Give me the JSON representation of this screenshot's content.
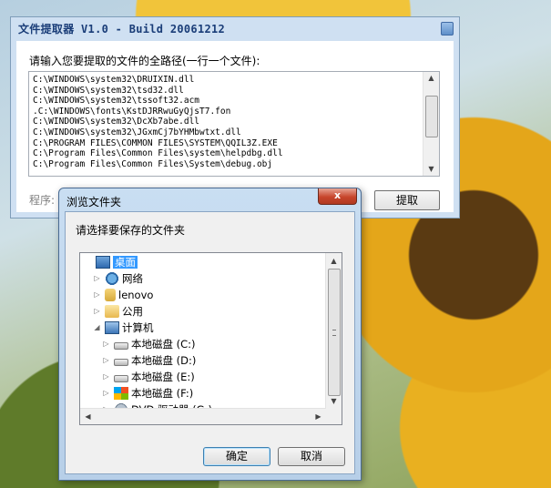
{
  "app": {
    "title": "文件提取器 V1.0 - Build 20061212",
    "prompt": "请输入您要提取的文件的全路径(一行一个文件):",
    "file_lines": [
      "C:\\WINDOWS\\system32\\DRUIXIN.dll",
      "C:\\WINDOWS\\system32\\tsd32.dll",
      "C:\\WINDOWS\\system32\\tssoft32.acm",
      ".C:\\WINDOWS\\fonts\\KstDJRRwuGyQjsT7.fon",
      "C:\\WINDOWS\\system32\\DcXb7abe.dll",
      "C:\\WINDOWS\\system32\\JGxmCj7bYHMbwtxt.dll",
      "C:\\PROGRAM FILES\\COMMON FILES\\SYSTEM\\QQIL3Z.EXE",
      "C:\\Program Files\\Common Files\\system\\helpdbg.dll",
      "C:\\Program Files\\Common Files\\System\\debug.obj"
    ],
    "status_label": "程序:",
    "extract_label": "提取"
  },
  "dialog": {
    "title": "浏览文件夹",
    "close_label": "x",
    "prompt": "请选择要保存的文件夹",
    "tree": [
      {
        "label": "桌面",
        "icon": "desktop-icon",
        "level": 0,
        "expander": "",
        "selected": true
      },
      {
        "label": "网络",
        "icon": "network-icon",
        "level": 1,
        "expander": "collapsed"
      },
      {
        "label": "lenovo",
        "icon": "user-folder-icon",
        "level": 1,
        "expander": "collapsed"
      },
      {
        "label": "公用",
        "icon": "folder-icon",
        "level": 1,
        "expander": "collapsed"
      },
      {
        "label": "计算机",
        "icon": "computer-icon",
        "level": 1,
        "expander": "expanded"
      },
      {
        "label": "本地磁盘 (C:)",
        "icon": "drive-icon",
        "level": 2,
        "expander": "collapsed"
      },
      {
        "label": "本地磁盘 (D:)",
        "icon": "drive-icon",
        "level": 2,
        "expander": "collapsed"
      },
      {
        "label": "本地磁盘 (E:)",
        "icon": "drive-icon",
        "level": 2,
        "expander": "collapsed"
      },
      {
        "label": "本地磁盘 (F:)",
        "icon": "windows-drive-icon",
        "level": 2,
        "expander": "collapsed"
      },
      {
        "label": "DVD 驱动器 (G:)",
        "icon": "dvd-drive-icon",
        "level": 2,
        "expander": "collapsed"
      }
    ],
    "ok_label": "确定",
    "cancel_label": "取消"
  },
  "colors": {
    "selection": "#3399ff",
    "app_title_text": "#1a3d78"
  }
}
